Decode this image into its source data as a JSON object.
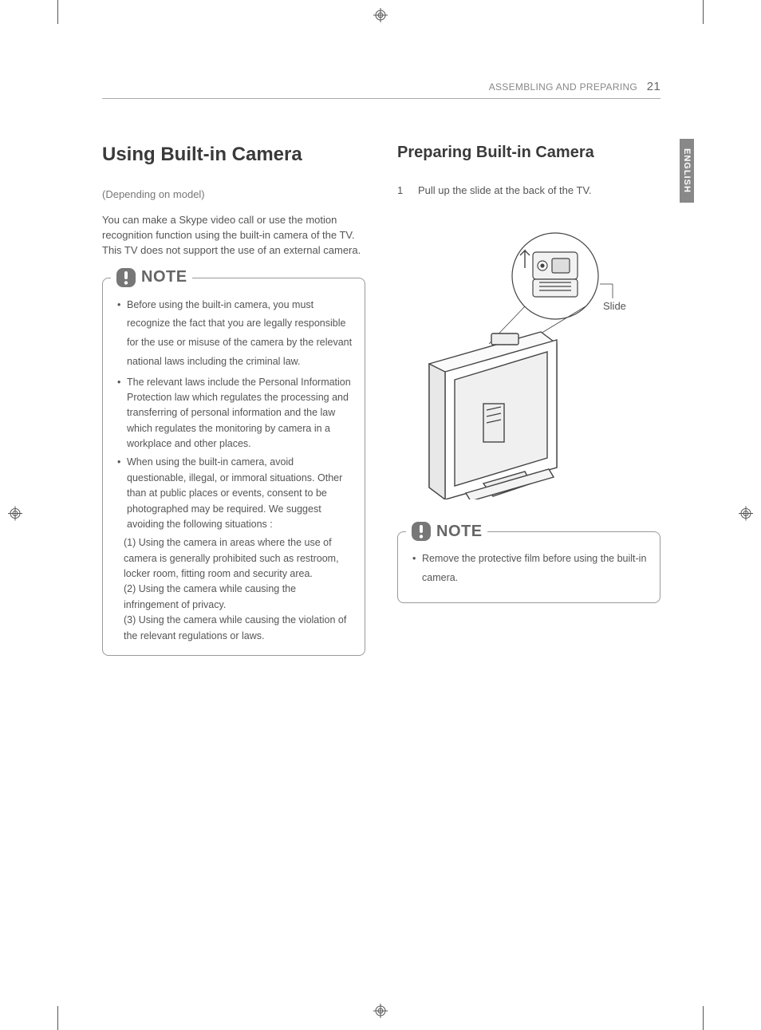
{
  "header": {
    "section": "ASSEMBLING AND PREPARING",
    "page_number": "21"
  },
  "language_tab": "ENGLISH",
  "left": {
    "h1": "Using Built-in Camera",
    "depends": "(Depending on model)",
    "intro": "You can make a Skype video call or use the motion recognition function using the built-in camera of the TV.  This TV does not support the use of an external camera.",
    "note_title": "NOTE",
    "note_items": [
      "Before using the built-in camera, you must recognize the fact that you are legally responsible for the use or misuse of the camera by the relevant national laws including the criminal law.",
      "The relevant laws include the Personal Information Protection law which regulates the processing and transferring of personal information and the law which regulates the monitoring by camera in a workplace and other places.",
      "When using the built-in camera, avoid questionable, illegal, or immoral situations. Other than at public places or events, consent to be photographed may be required. We suggest avoiding the following situations :"
    ],
    "note_subitems": [
      "(1) Using the camera in areas where the use of camera is generally prohibited such as restroom, locker room, fitting room and security area.",
      "(2) Using the camera while causing the infringement of privacy.",
      "(3) Using the camera while causing the violation of the relevant regulations or laws."
    ]
  },
  "right": {
    "h2": "Preparing Built-in Camera",
    "step_num": "1",
    "step_text": "Pull up the slide at the back of the TV.",
    "figure_label": "Slide",
    "note_title": "NOTE",
    "note_items": [
      "Remove the protective film before using the built-in camera."
    ]
  }
}
